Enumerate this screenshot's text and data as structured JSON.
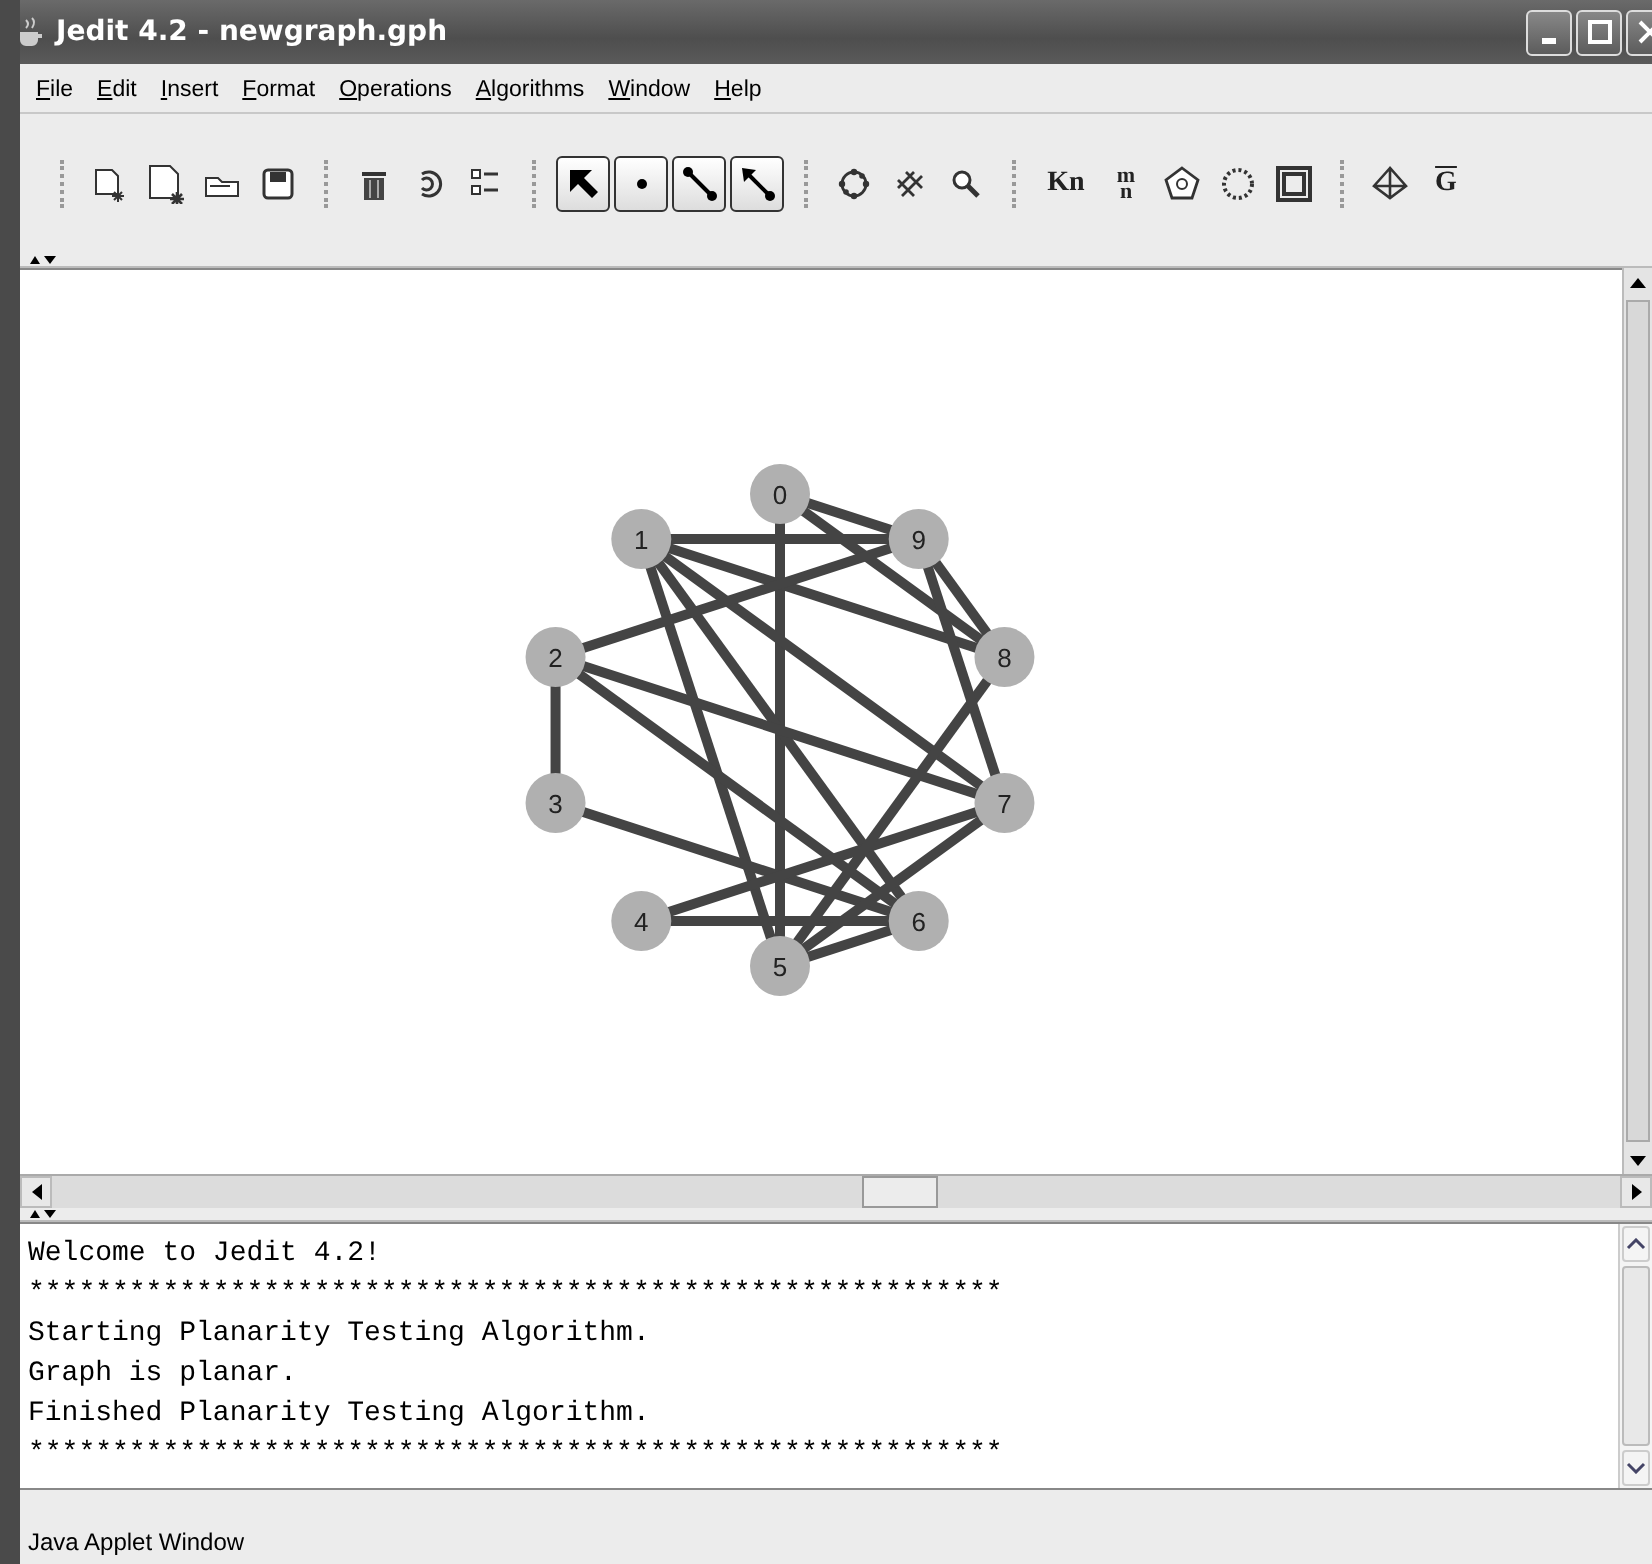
{
  "window": {
    "title": "Jedit 4.2 - newgraph.gph"
  },
  "menu": [
    {
      "label": "File"
    },
    {
      "label": "Edit"
    },
    {
      "label": "Insert"
    },
    {
      "label": "Format"
    },
    {
      "label": "Operations"
    },
    {
      "label": "Algorithms"
    },
    {
      "label": "Window"
    },
    {
      "label": "Help"
    }
  ],
  "toolbar": {
    "complete_graph": "Kn",
    "bipartite_top": "m",
    "bipartite_bottom": "n",
    "complement": "G"
  },
  "graph": {
    "nodes": [
      {
        "label": "0"
      },
      {
        "label": "1"
      },
      {
        "label": "2"
      },
      {
        "label": "3"
      },
      {
        "label": "4"
      },
      {
        "label": "5"
      },
      {
        "label": "6"
      },
      {
        "label": "7"
      },
      {
        "label": "8"
      },
      {
        "label": "9"
      }
    ]
  },
  "console": [
    "Welcome to Jedit 4.2!",
    "**********************************************************",
    "Starting Planarity Testing Algorithm.",
    "Graph is planar.",
    "Finished Planarity Testing Algorithm.",
    "**********************************************************"
  ],
  "status_bar": "Java Applet Window"
}
